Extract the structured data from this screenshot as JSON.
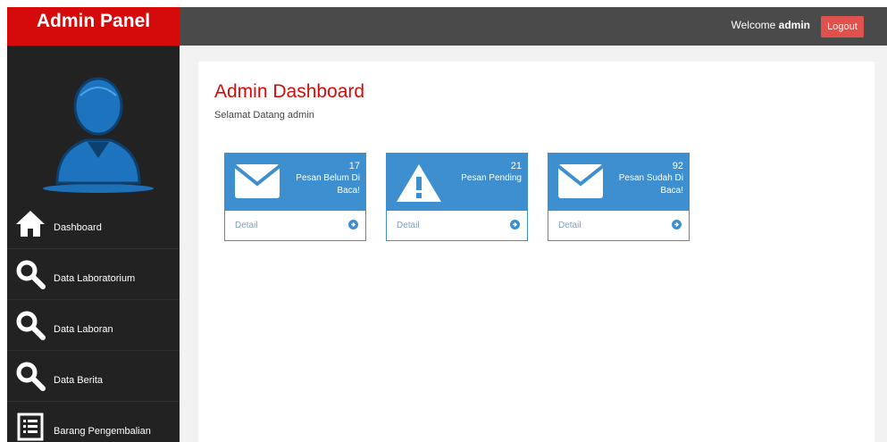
{
  "brand": {
    "title": "Admin Panel",
    "color": "#d50b0b"
  },
  "topbar": {
    "welcome_prefix": "Welcome ",
    "username": "admin",
    "logout_label": "Logout",
    "logout_color": "#e0514d"
  },
  "sidebar": {
    "avatar_icon": "user-avatar-icon",
    "items": [
      {
        "label": "Dashboard",
        "icon": "home-icon"
      },
      {
        "label": "Data Laboratorium",
        "icon": "search-icon"
      },
      {
        "label": "Data Laboran",
        "icon": "search-icon"
      },
      {
        "label": "Data Berita",
        "icon": "search-icon"
      },
      {
        "label": "Barang Pengembalian",
        "icon": "list-icon"
      }
    ]
  },
  "main": {
    "title": "Admin Dashboard",
    "subtitle": "Selamat Datang admin",
    "accent": "#3e8fd0",
    "cards": [
      {
        "count": "17",
        "label": "Pesan Belum Di Baca!",
        "icon": "envelope-icon",
        "footer": "Detail"
      },
      {
        "count": "21",
        "label": "Pesan Pending",
        "icon": "warning-icon",
        "footer": "Detail"
      },
      {
        "count": "92",
        "label": "Pesan Sudah Di Baca!",
        "icon": "envelope-icon",
        "footer": "Detail"
      }
    ]
  }
}
